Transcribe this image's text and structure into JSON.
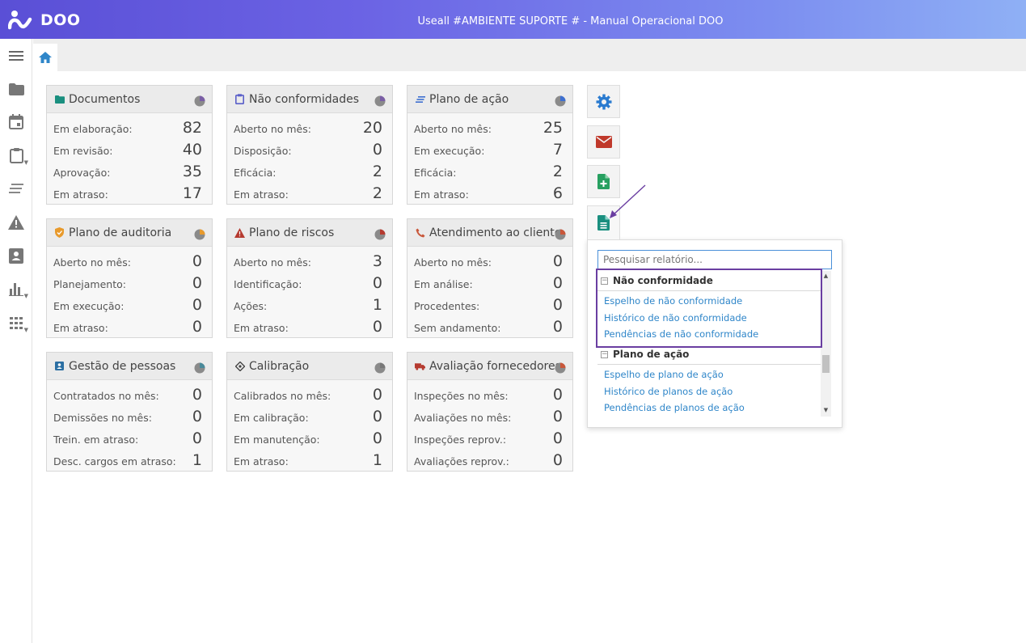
{
  "app": {
    "logo_text": "DOO",
    "window_title": "Useall #AMBIENTE SUPORTE # - Manual Operacional DOO",
    "brand_colors": {
      "header_start": "#5a4fd6",
      "header_end": "#8fb0f5",
      "accent_blue": "#2f86c9",
      "highlight": "#6a3ea1"
    }
  },
  "sidebar": {
    "items": [
      {
        "icon": "menu-icon"
      },
      {
        "icon": "folder-icon"
      },
      {
        "icon": "calendar-icon"
      },
      {
        "icon": "clipboard-icon"
      },
      {
        "icon": "lines-icon"
      },
      {
        "icon": "warning-icon"
      },
      {
        "icon": "contact-card-icon"
      },
      {
        "icon": "bar-chart-icon"
      },
      {
        "icon": "apps-grid-icon"
      }
    ]
  },
  "tabs": [
    {
      "icon": "home-icon"
    }
  ],
  "cards": [
    {
      "title": "Documentos",
      "icon": "folder-icon",
      "icon_color": "#1a8f7f",
      "pie_color": "#7a5ea5",
      "rows": [
        {
          "label": "Em elaboração:",
          "value": "82"
        },
        {
          "label": "Em revisão:",
          "value": "40"
        },
        {
          "label": "Aprovação:",
          "value": "35"
        },
        {
          "label": "Em atraso:",
          "value": "17"
        }
      ]
    },
    {
      "title": "Não conformidades",
      "icon": "clipboard-icon",
      "icon_color": "#5a5fc9",
      "pie_color": "#7a5ea5",
      "rows": [
        {
          "label": "Aberto no mês:",
          "value": "20"
        },
        {
          "label": "Disposição:",
          "value": "0"
        },
        {
          "label": "Eficácia:",
          "value": "2"
        },
        {
          "label": "Em atraso:",
          "value": "2"
        }
      ]
    },
    {
      "title": "Plano de ação",
      "icon": "lines-icon",
      "icon_color": "#3d6fd0",
      "pie_color": "#3d6fd0",
      "rows": [
        {
          "label": "Aberto no mês:",
          "value": "25"
        },
        {
          "label": "Em execução:",
          "value": "7"
        },
        {
          "label": "Eficácia:",
          "value": "2"
        },
        {
          "label": "Em atraso:",
          "value": "6"
        }
      ]
    },
    {
      "title": "Plano de auditoria",
      "icon": "shield-icon",
      "icon_color": "#e89a2c",
      "pie_color": "#e89a2c",
      "rows": [
        {
          "label": "Aberto no mês:",
          "value": "0"
        },
        {
          "label": "Planejamento:",
          "value": "0"
        },
        {
          "label": "Em execução:",
          "value": "0"
        },
        {
          "label": "Em atraso:",
          "value": "0"
        }
      ]
    },
    {
      "title": "Plano de riscos",
      "icon": "warning-icon",
      "icon_color": "#b53a2f",
      "pie_color": "#b53a2f",
      "rows": [
        {
          "label": "Aberto no mês:",
          "value": "3"
        },
        {
          "label": "Identificação:",
          "value": "0"
        },
        {
          "label": "Ações:",
          "value": "1"
        },
        {
          "label": "Em atraso:",
          "value": "0"
        }
      ]
    },
    {
      "title": "Atendimento ao cliente",
      "icon": "phone-icon",
      "icon_color": "#c9573a",
      "pie_color": "#c9573a",
      "rows": [
        {
          "label": "Aberto no mês:",
          "value": "0"
        },
        {
          "label": "Em análise:",
          "value": "0"
        },
        {
          "label": "Procedentes:",
          "value": "0"
        },
        {
          "label": "Sem andamento:",
          "value": "0"
        }
      ]
    },
    {
      "title": "Gestão de pessoas",
      "icon": "person-card-icon",
      "icon_color": "#2b6fa3",
      "pie_color": "#4a8a9a",
      "rows": [
        {
          "label": "Contratados no mês:",
          "value": "0"
        },
        {
          "label": "Demissões no mês:",
          "value": "0"
        },
        {
          "label": "Trein. em atraso:",
          "value": "0"
        },
        {
          "label": "Desc. cargos em atraso:",
          "value": "1"
        }
      ]
    },
    {
      "title": "Calibração",
      "icon": "target-icon",
      "icon_color": "#444444",
      "pie_color": "#777777",
      "rows": [
        {
          "label": "Calibrados no mês:",
          "value": "0"
        },
        {
          "label": "Em calibração:",
          "value": "0"
        },
        {
          "label": "Em manutenção:",
          "value": "0"
        },
        {
          "label": "Em atraso:",
          "value": "1"
        }
      ]
    },
    {
      "title": "Avaliação fornecedores",
      "icon": "truck-icon",
      "icon_color": "#b53a2f",
      "pie_color": "#c9573a",
      "rows": [
        {
          "label": "Inspeções no mês:",
          "value": "0"
        },
        {
          "label": "Avaliações no mês:",
          "value": "0"
        },
        {
          "label": "Inspeções reprov.:",
          "value": "0"
        },
        {
          "label": "Avaliações reprov.:",
          "value": "0"
        }
      ]
    }
  ],
  "actions": [
    {
      "icon": "gear-icon",
      "color": "#2a7bd0"
    },
    {
      "icon": "mail-icon",
      "color": "#c0392b"
    },
    {
      "icon": "file-add-icon",
      "color": "#27a060"
    },
    {
      "icon": "file-text-icon",
      "color": "#1a8f7f"
    }
  ],
  "report_panel": {
    "search_placeholder": "Pesquisar relatório...",
    "groups": [
      {
        "label": "Não conformidade",
        "items": [
          "Espelho de não conformidade",
          "Histórico de não conformidade",
          "Pendências de não conformidade"
        ]
      },
      {
        "label": "Plano de ação",
        "items": [
          "Espelho de plano de ação",
          "Histórico de planos de ação",
          "Pendências de planos de ação"
        ]
      }
    ]
  }
}
